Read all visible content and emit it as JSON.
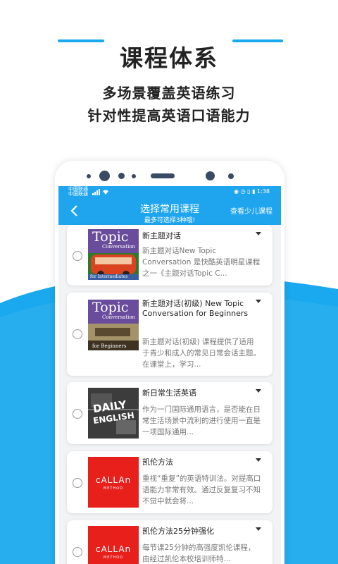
{
  "promo": {
    "headline": "课程体系",
    "line1": "多场景覆盖英语练习",
    "line2": "针对性提高英语口语能力",
    "accent": "#1aa8ee"
  },
  "status": {
    "carrier1": "中国联通",
    "carrier2": "中国联通",
    "time": "1:38"
  },
  "nav": {
    "title": "选择常用课程",
    "subtitle": "最多可选择3种哦!",
    "action": "查看少儿课程",
    "color": "#1ea5ee"
  },
  "courses": [
    {
      "title": "新主题对话",
      "desc": "新主题对话New Topic Conversation 是快酷英语明星课程之一《主题对话Topic C...",
      "thumb": {
        "line1": "Topic",
        "line2": "Conversation",
        "line3": "for Intermediates"
      }
    },
    {
      "title": "新主题对话(初级) New Topic Conversation for Beginners",
      "desc": "新主题对话(初级) 课程提供了适用于青少和成人的常见日常会话主题。在课堂上，学习...",
      "thumb": {
        "line1": "Topic",
        "line2": "Conversation",
        "line3": "for Beginners"
      }
    },
    {
      "title": "新日常生活英语",
      "desc": "作为一门国际通用语言，是否能在日常生活场景中流利的进行使用一直是一项国际通用...",
      "thumb": {
        "line1": "DAILY",
        "line2": "ENGLISH"
      }
    },
    {
      "title": "凯伦方法",
      "desc": "重视“重复”的英语特训法。对提高口语能力非常有效。通过反复复习不知不觉中就会将...",
      "thumb": {
        "line1": "cALLAn",
        "line2": "METHOD"
      }
    },
    {
      "title": "凯伦方法25分钟强化",
      "desc": "每节课25分钟的高强度凯伦课程，由经过凯伦本校培训师特...",
      "thumb": {
        "line1": "cALLAn",
        "line2": "METHOD"
      }
    }
  ]
}
